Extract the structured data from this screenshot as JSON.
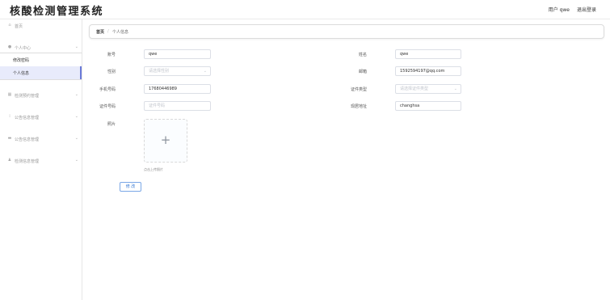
{
  "header": {
    "app_title": "核酸检测管理系统",
    "user_label": "用户 qwe",
    "logout_label": "退出登录"
  },
  "sidebar": {
    "home": "首页",
    "personal_center": "个人中心",
    "change_password": "修改密码",
    "personal_info": "个人信息",
    "test_booking_mgmt": "检测预约管理",
    "notice_mgmt": "公告信息管理",
    "announcement_mgmt": "公告信息管理",
    "test_info_mgmt": "检测信息管理"
  },
  "breadcrumb": {
    "home": "首页",
    "separator": "/",
    "current": "个人信息"
  },
  "form": {
    "account_label": "账号",
    "account_value": "qwe",
    "name_label": "姓名",
    "name_value": "qwe",
    "gender_label": "性别",
    "gender_placeholder": "请选择性别",
    "email_label": "邮箱",
    "email_value": "1592594197@qq.com",
    "phone_label": "手机号码",
    "phone_value": "17680446989",
    "id_type_label": "证件类型",
    "id_type_placeholder": "请选择证件类型",
    "id_number_label": "证件号码",
    "id_number_placeholder": "证件号码",
    "address_label": "现居地址",
    "address_value": "changhsa",
    "photo_label": "照片",
    "upload_hint": "点击上传照片",
    "submit_label": "修 改"
  },
  "colors": {
    "active_menu_bg": "#e8ebfb",
    "active_menu_border": "#6a7ad8",
    "button_border": "#7aa7e6",
    "button_text": "#3a7bd5"
  }
}
